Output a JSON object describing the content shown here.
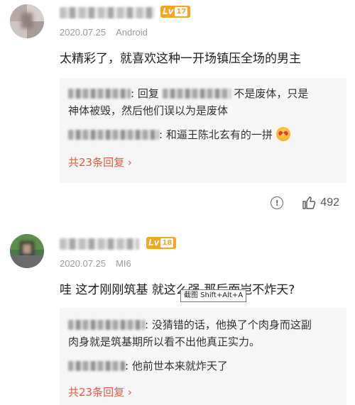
{
  "comments": [
    {
      "level": "17",
      "date": "2020.07.25",
      "device": "Android",
      "text": "太精彩了，就喜欢这种一开场镇压全场的男主",
      "replies": [
        {
          "prefix": "回复",
          "text": "不是废体，只是",
          "text2": "神体被毁，然后他们误以为是废体"
        },
        {
          "text": "和逼王陈北玄有的一拼"
        }
      ],
      "more_replies": "共23条回复",
      "like_count": "492"
    },
    {
      "level": "18",
      "date": "2020.07.25",
      "device": "MI6",
      "text": "哇 这才刚刚筑基 就这么强 那后面岂不炸天?",
      "replies": [
        {
          "text": "没猜错的话，他换了个肉身而这副",
          "text2": "肉身就是筑基期所以看不出他真正实力。"
        },
        {
          "text": "他前世本来就炸天了"
        }
      ],
      "more_replies": "共23条回复"
    }
  ],
  "lv_label": "Lv",
  "tooltip": "截图 Shift+Alt+A",
  "icons": {
    "report": "report-icon",
    "like": "thumbs-up-icon",
    "chevron": "chevron-right-icon",
    "emoji": "heart-eyes-emoji"
  }
}
